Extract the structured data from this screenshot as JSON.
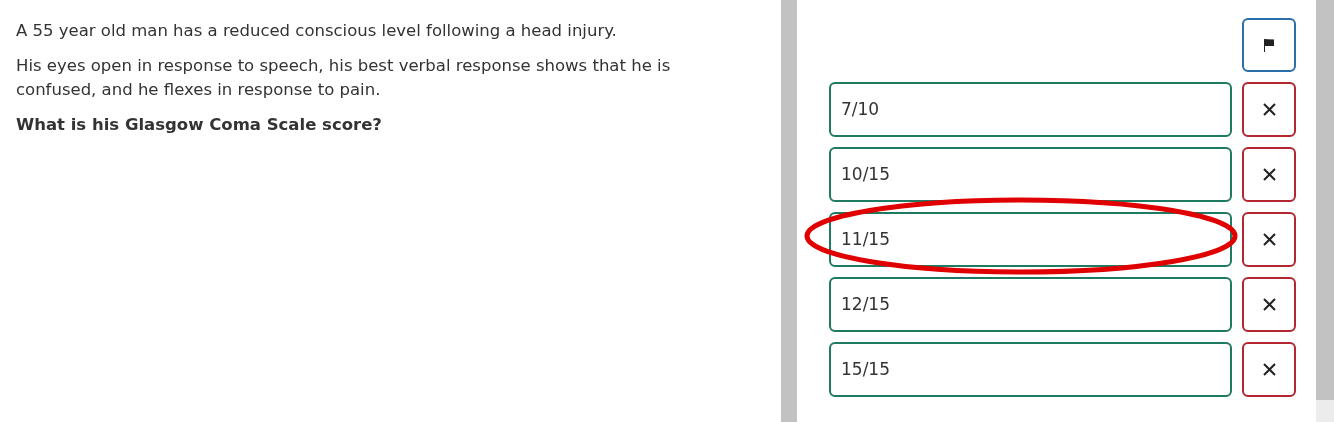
{
  "question": {
    "paragraphs": [
      "A 55 year old man has a reduced conscious level following a head injury.",
      "His eyes open in response to speech, his best verbal response shows that he is confused, and he flexes in response to pain."
    ],
    "prompt": "What is his Glasgow Coma Scale score?"
  },
  "options": [
    {
      "label": "7/10",
      "circled": false
    },
    {
      "label": "10/15",
      "circled": false
    },
    {
      "label": "11/15",
      "circled": true
    },
    {
      "label": "12/15",
      "circled": false
    },
    {
      "label": "15/15",
      "circled": false
    }
  ]
}
